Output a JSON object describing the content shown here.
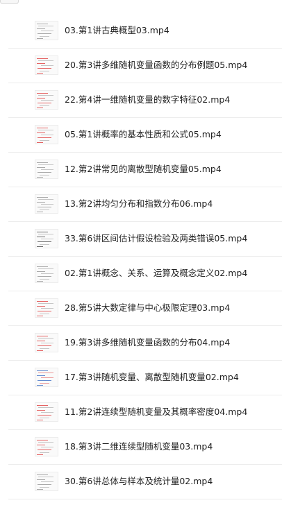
{
  "files": [
    {
      "name": "03.第1讲古典概型03.mp4",
      "thumb": "gray"
    },
    {
      "name": "20.第3讲多维随机变量函数的分布例题05.mp4",
      "thumb": "red"
    },
    {
      "name": "22.第4讲一维随机变量的数字特征02.mp4",
      "thumb": "red"
    },
    {
      "name": "05.第1讲概率的基本性质和公式05.mp4",
      "thumb": "red"
    },
    {
      "name": "12.第2讲常见的离散型随机变量05.mp4",
      "thumb": "gray"
    },
    {
      "name": "13.第2讲均匀分布和指数分布06.mp4",
      "thumb": "gray"
    },
    {
      "name": "33.第6讲区间估计假设检验及两类错误05.mp4",
      "thumb": "dark"
    },
    {
      "name": "02.第1讲概念、关系、运算及概念定义02.mp4",
      "thumb": "gray"
    },
    {
      "name": "28.第5讲大数定律与中心极限定理03.mp4",
      "thumb": "red"
    },
    {
      "name": "19.第3讲多维随机变量函数的分布04.mp4",
      "thumb": "red"
    },
    {
      "name": "17.第3讲随机变量、离散型随机变量02.mp4",
      "thumb": "blue"
    },
    {
      "name": "11.第2讲连续型随机变量及其概率密度04.mp4",
      "thumb": "red"
    },
    {
      "name": "18.第3讲二维连续型随机变量03.mp4",
      "thumb": "red"
    },
    {
      "name": "30.第6讲总体与样本及统计量02.mp4",
      "thumb": "gray"
    }
  ],
  "colors": {
    "text": "#222222",
    "divider": "#ececec",
    "thumb_red": "#e04848",
    "thumb_gray": "#9a9a9a",
    "thumb_dark": "#555555",
    "thumb_blue": "#4a78c8"
  }
}
